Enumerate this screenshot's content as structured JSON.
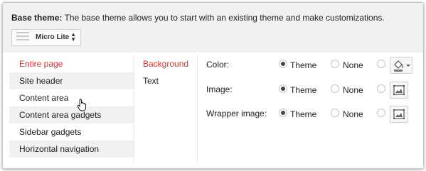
{
  "header": {
    "label": "Base theme:",
    "description": "The base theme allows you to start with an existing theme and make customizations.",
    "theme_select": {
      "value": "Micro Lite"
    }
  },
  "nav": {
    "items": [
      {
        "label": "Entire page",
        "active": true
      },
      {
        "label": "Site header"
      },
      {
        "label": "Content area"
      },
      {
        "label": "Content area gadgets"
      },
      {
        "label": "Sidebar gadgets"
      },
      {
        "label": "Horizontal navigation"
      }
    ]
  },
  "subnav": {
    "items": [
      {
        "label": "Background",
        "active": true
      },
      {
        "label": "Text"
      }
    ]
  },
  "options": [
    {
      "label": "Color:",
      "theme_label": "Theme",
      "none_label": "None",
      "selected": "theme",
      "custom_icon": "paint-bucket-icon"
    },
    {
      "label": "Image:",
      "theme_label": "Theme",
      "none_label": "None",
      "selected": "theme",
      "custom_icon": "image-icon"
    },
    {
      "label": "Wrapper image:",
      "theme_label": "Theme",
      "none_label": "None",
      "selected": "theme",
      "custom_icon": "image-icon"
    }
  ],
  "colors": {
    "accent_red": "#cc3333",
    "panel_gray": "#f1f1f1",
    "border": "#cfcfcf"
  }
}
